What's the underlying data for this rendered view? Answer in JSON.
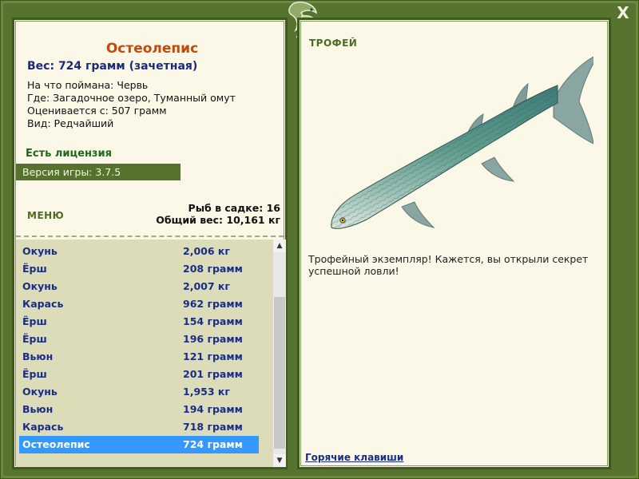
{
  "close_label": "X",
  "fish": {
    "name": "Остеолепис",
    "weight_line": "Вес: 724 грамм (зачетная)",
    "info": [
      "На что поймана: Червь",
      "Где: Загадочное озеро, Туманный омут",
      "Оценивается с: 507 грамм",
      "Вид: Редчайший"
    ]
  },
  "license": "Есть лицензия",
  "version": "Версия игры: 3.7.5",
  "menu_label": "МЕНЮ",
  "stats": {
    "count": "Рыб в садке: 16",
    "total": "Общий вес: 10,161 кг"
  },
  "catch_list": [
    {
      "name": "Окунь",
      "weight": "2,006 кг"
    },
    {
      "name": "Ёрш",
      "weight": "208 грамм"
    },
    {
      "name": "Окунь",
      "weight": "2,007 кг"
    },
    {
      "name": "Карась",
      "weight": "962 грамм"
    },
    {
      "name": "Ёрш",
      "weight": "154 грамм"
    },
    {
      "name": "Ёрш",
      "weight": "196 грамм"
    },
    {
      "name": "Вьюн",
      "weight": "121 грамм"
    },
    {
      "name": "Ёрш",
      "weight": "201 грамм"
    },
    {
      "name": "Окунь",
      "weight": "1,953 кг"
    },
    {
      "name": "Вьюн",
      "weight": "194 грамм"
    },
    {
      "name": "Карась",
      "weight": "718 грамм"
    },
    {
      "name": "Остеолепис",
      "weight": "724 грамм",
      "selected": true
    }
  ],
  "trophy": {
    "label": "ТРОФЕЙ",
    "text": "Трофейный экземпляр! Кажется, вы открыли секрет успешной ловли!"
  },
  "hotkeys_label": "Горячие клавиши",
  "colors": {
    "frame": "#56742f",
    "panel_bg": "#fbf8e7",
    "list_bg": "#dcdcb8",
    "selection": "#3399ff",
    "fish_name": "#c24a0e",
    "list_text": "#1a2d86"
  }
}
